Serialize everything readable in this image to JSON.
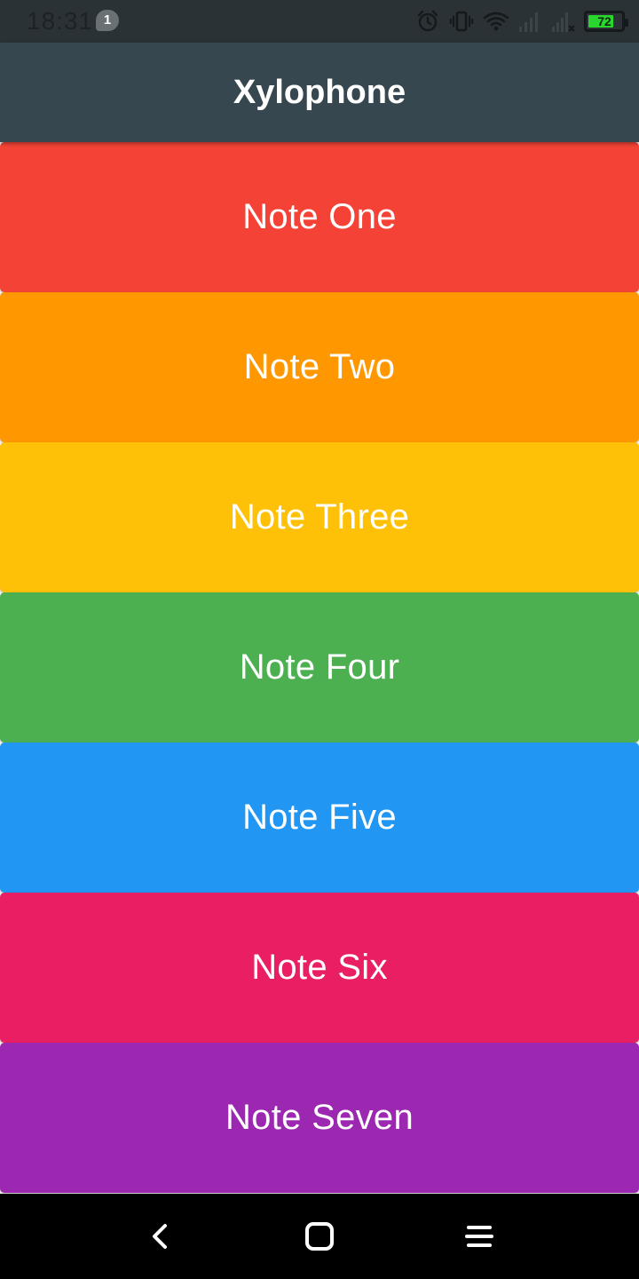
{
  "status_bar": {
    "time": "18:31",
    "notification_count": "1",
    "battery_level": "72",
    "icons": [
      "alarm-icon",
      "vibrate-icon",
      "wifi-icon",
      "signal-icon",
      "signal-off-icon",
      "battery-icon"
    ]
  },
  "app_bar": {
    "title": "Xylophone"
  },
  "keys": [
    {
      "label": "Note One",
      "color": "#f44336"
    },
    {
      "label": "Note Two",
      "color": "#ff9800"
    },
    {
      "label": "Note Three",
      "color": "#ffc107"
    },
    {
      "label": "Note Four",
      "color": "#4caf50"
    },
    {
      "label": "Note Five",
      "color": "#2196f3"
    },
    {
      "label": "Note Six",
      "color": "#e91e63"
    },
    {
      "label": "Note Seven",
      "color": "#9c27b0"
    }
  ],
  "nav_bar": {
    "icons": [
      "back-icon",
      "home-icon",
      "menu-icon"
    ]
  }
}
